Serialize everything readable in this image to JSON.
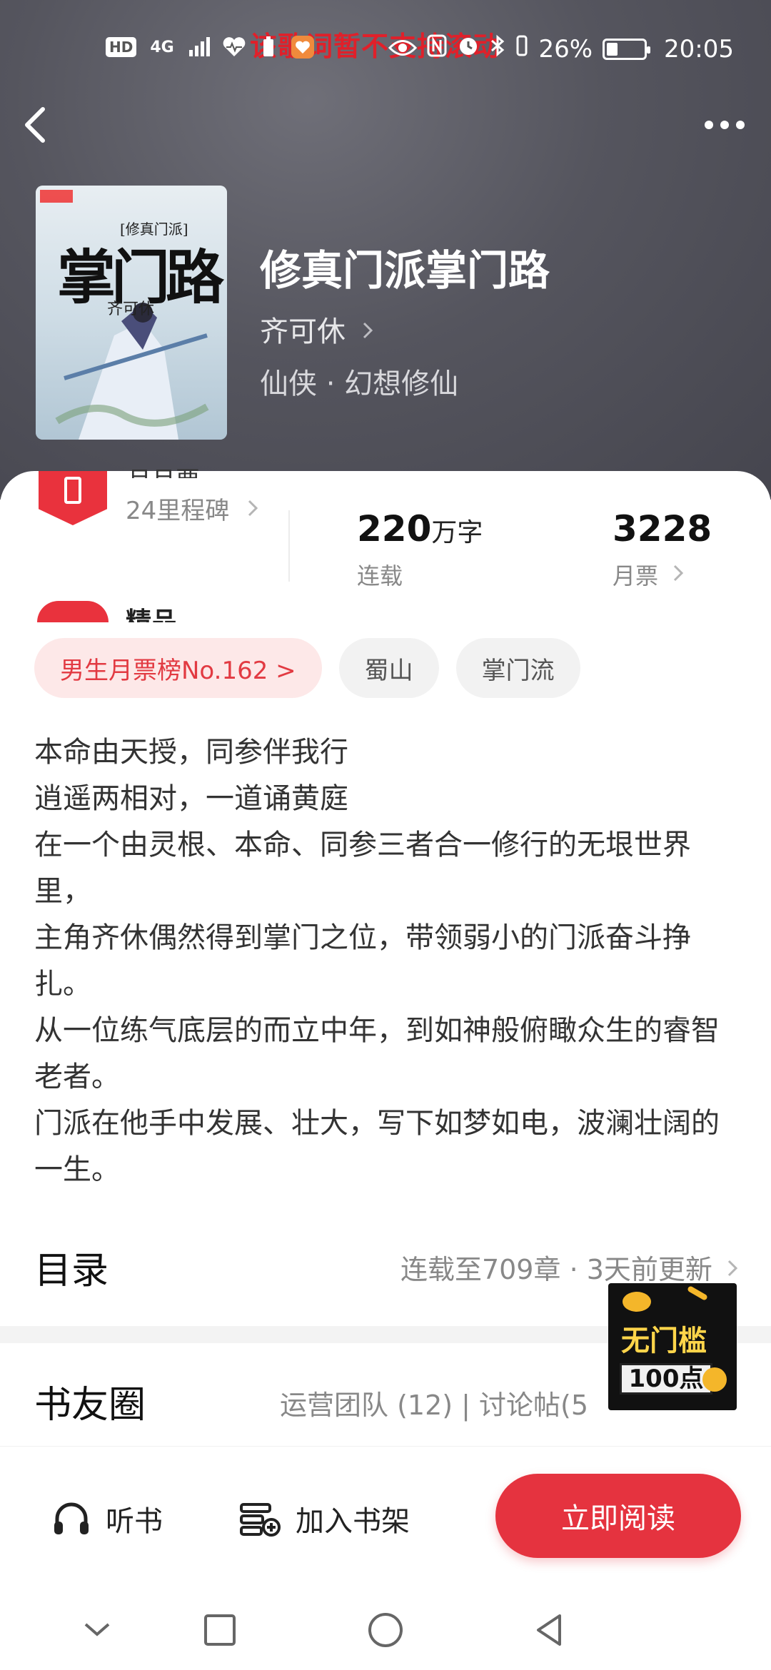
{
  "status_bar": {
    "overlay_text": "该歌词暂不支持滚动",
    "left_chips": [
      "HD",
      "4G"
    ],
    "battery_text": "26%",
    "battery_level": 0.26,
    "time": "20:05",
    "icons": [
      "signal-icon",
      "heart-monitor-icon",
      "battery-small-icon",
      "app-notification-icon",
      "eye-icon",
      "nfc-icon",
      "alarm-icon",
      "bluetooth-icon",
      "vibrate-icon"
    ]
  },
  "header": {
    "back_icon": "back-chevron-icon",
    "more_icon": "more-dots-icon"
  },
  "book": {
    "cover": {
      "series": "[修真门派]",
      "title_art": "掌门路",
      "author": "齐可休"
    },
    "title": "修真门派掌门路",
    "author": "齐可休",
    "genre": "仙侠 · 幻想修仙"
  },
  "stats": {
    "rank_title": "月月票",
    "rank_link": "24里程碑",
    "words_num": "220",
    "words_unit": "万字",
    "words_label": "连载",
    "votes_num": "3228",
    "votes_label": "月票",
    "quality_text": "精品"
  },
  "tags": [
    {
      "label": "男生月票榜No.162 >",
      "hot": true
    },
    {
      "label": "蜀山",
      "hot": false
    },
    {
      "label": "掌门流",
      "hot": false
    }
  ],
  "synopsis": [
    "本命由天授，同参伴我行",
    "逍遥两相对，一道诵黄庭",
    "在一个由灵根、本命、同参三者合一修行的无垠世界里，",
    "主角齐休偶然得到掌门之位，带领弱小的门派奋斗挣扎。",
    "从一位练气底层的而立中年，到如神般俯瞰众生的睿智老者。",
    "门派在他手中发展、壮大，写下如梦如电，波澜壮阔的一生。"
  ],
  "toc": {
    "title": "目录",
    "meta": "连载至709章 · 3天前更新"
  },
  "book_circle": {
    "title": "书友圈",
    "meta": "运营团队 (12) | 讨论帖(5"
  },
  "float_ad": {
    "top_text": "无门槛",
    "bottom_text": "100点"
  },
  "bottom_bar": {
    "listen_label": "听书",
    "shelf_label": "加入书架",
    "read_label": "立即阅读"
  },
  "nav": [
    "nav-down-icon",
    "nav-square-icon",
    "nav-circle-icon",
    "nav-back-icon"
  ]
}
